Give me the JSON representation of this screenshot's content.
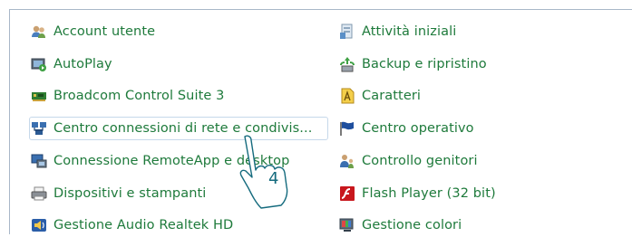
{
  "items_left": [
    {
      "label": "Account utente",
      "icon": "users-icon"
    },
    {
      "label": "AutoPlay",
      "icon": "autoplay-icon"
    },
    {
      "label": "Broadcom Control Suite 3",
      "icon": "network-card-icon"
    },
    {
      "label": "Centro connessioni di rete e condivis...",
      "icon": "network-center-icon"
    },
    {
      "label": "Connessione RemoteApp e desktop",
      "icon": "remote-desktop-icon"
    },
    {
      "label": "Dispositivi e stampanti",
      "icon": "printer-icon"
    },
    {
      "label": "Gestione Audio Realtek HD",
      "icon": "audio-icon"
    }
  ],
  "items_right": [
    {
      "label": "Attività iniziali",
      "icon": "getting-started-icon"
    },
    {
      "label": "Backup e ripristino",
      "icon": "backup-icon"
    },
    {
      "label": "Caratteri",
      "icon": "fonts-icon"
    },
    {
      "label": "Centro operativo",
      "icon": "flag-icon"
    },
    {
      "label": "Controllo genitori",
      "icon": "parental-controls-icon"
    },
    {
      "label": "Flash Player (32 bit)",
      "icon": "flash-icon"
    },
    {
      "label": "Gestione colori",
      "icon": "color-management-icon"
    }
  ],
  "annotation": {
    "step_number": "4"
  },
  "colors": {
    "link": "#1e7a3b",
    "annotation": "#156b7e",
    "hover_border": "#c6d8ea"
  }
}
